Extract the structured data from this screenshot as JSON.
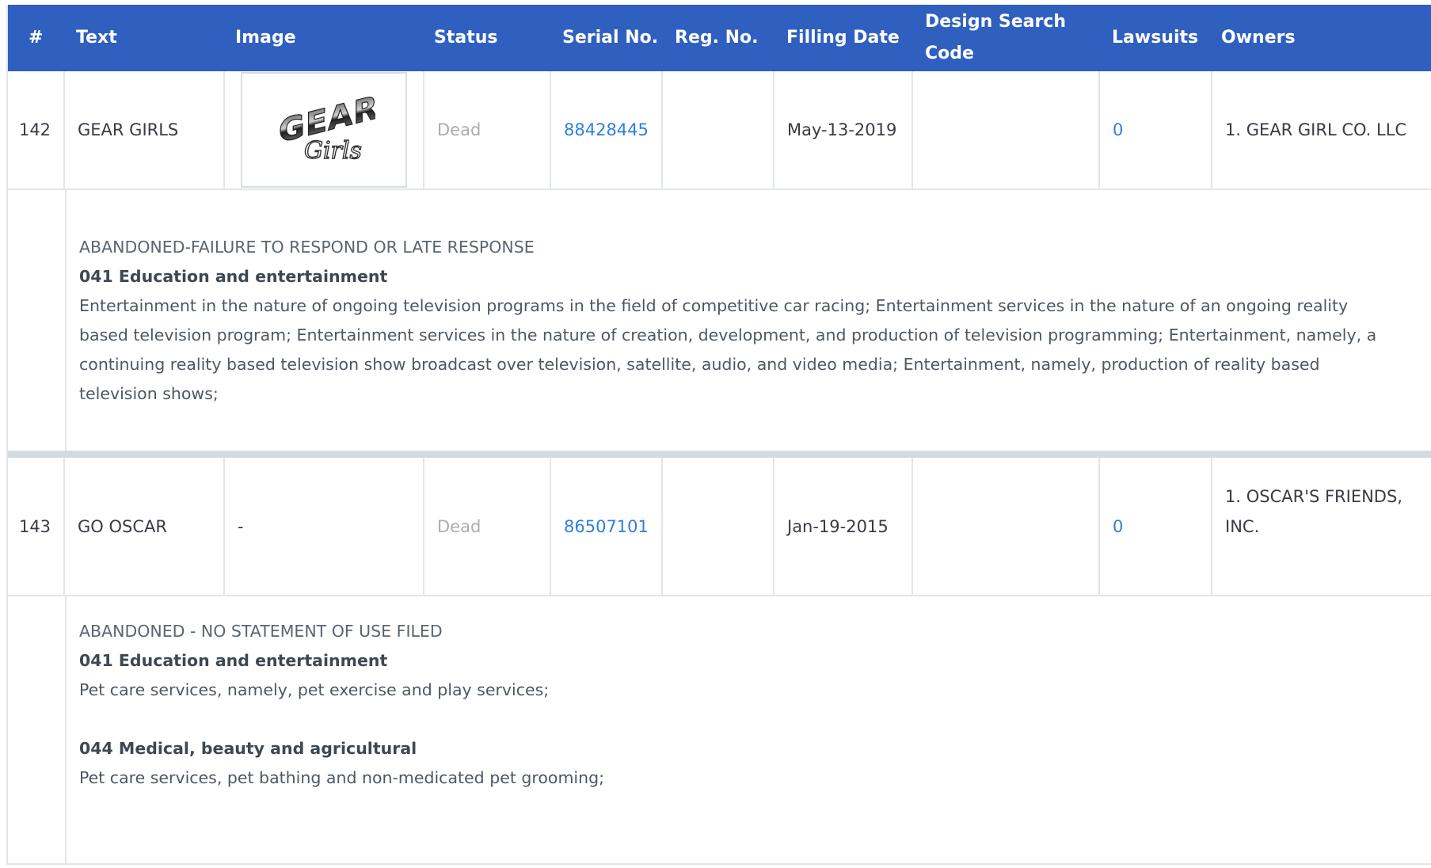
{
  "header": {
    "num": "#",
    "text": "Text",
    "image": "Image",
    "status": "Status",
    "serial": "Serial No.",
    "reg": "Reg. No.",
    "filling": "Filling Date",
    "design_line1": "Design Search",
    "design_line2": "Code",
    "lawsuits": "Lawsuits",
    "owners": "Owners"
  },
  "rows": [
    {
      "num": "142",
      "text": "GEAR GIRLS",
      "image_alt": "GEAR Girls logo",
      "status": "Dead",
      "serial": "88428445",
      "reg": "",
      "filling": "May-13-2019",
      "design": "",
      "lawsuits": "0",
      "owners": "1. GEAR GIRL CO. LLC",
      "detail_status": "ABANDONED-FAILURE TO RESPOND OR LATE RESPONSE",
      "classes": [
        {
          "title": "041 Education and entertainment",
          "desc": "Entertainment in the nature of ongoing television programs in the field of competitive car racing; Entertainment services in the nature of an ongoing reality based television program; Entertainment services in the nature of creation, development, and production of television programming; Entertainment, namely, a continuing reality based television show broadcast over television, satellite, audio, and video media; Entertainment, namely, production of reality based television shows;"
        }
      ]
    },
    {
      "num": "143",
      "text": "GO OSCAR",
      "image_text": "-",
      "status": "Dead",
      "serial": "86507101",
      "reg": "",
      "filling": "Jan-19-2015",
      "design": "",
      "lawsuits": "0",
      "owners_line1": "1. OSCAR'S FRIENDS,",
      "owners_line2": "INC.",
      "detail_status": "ABANDONED - NO STATEMENT OF USE FILED",
      "classes": [
        {
          "title": "041 Education and entertainment",
          "desc": "Pet care services, namely, pet exercise and play services;"
        },
        {
          "title": "044 Medical, beauty and agricultural",
          "desc": "Pet care services, pet bathing and non-medicated pet grooming;"
        }
      ]
    }
  ],
  "colors": {
    "header_bg": "#2f5fbf",
    "link": "#2d7fe0",
    "dead": "#a9adb3",
    "separator": "#d3dbe0"
  }
}
